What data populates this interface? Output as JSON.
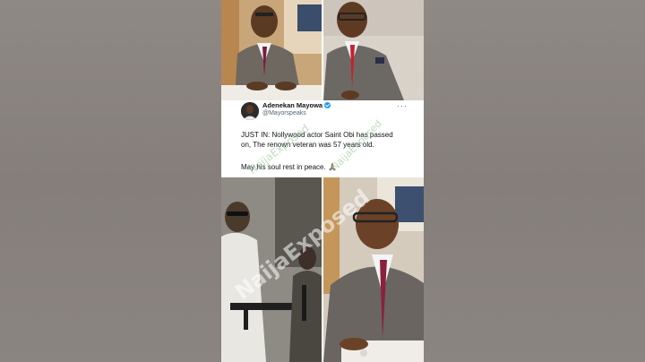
{
  "tweet": {
    "author_name": "Adenekan Mayowa",
    "author_handle": "@Mayorspeaks",
    "text_line1": "JUST IN: Nollywood actor Saint Obi has passed on, The renown veteran was 57 years old.",
    "text_line2": "May his soul rest in peace.",
    "emoji": "🙏🏽",
    "more": "···"
  },
  "watermark": {
    "main": "NaijaExposed",
    "secondary_1": "NaijaExposed",
    "secondary_2": "NaijaExposed"
  },
  "colors": {
    "verified": "#1d9bf0",
    "background": "#8a8480",
    "card": "#ffffff"
  }
}
